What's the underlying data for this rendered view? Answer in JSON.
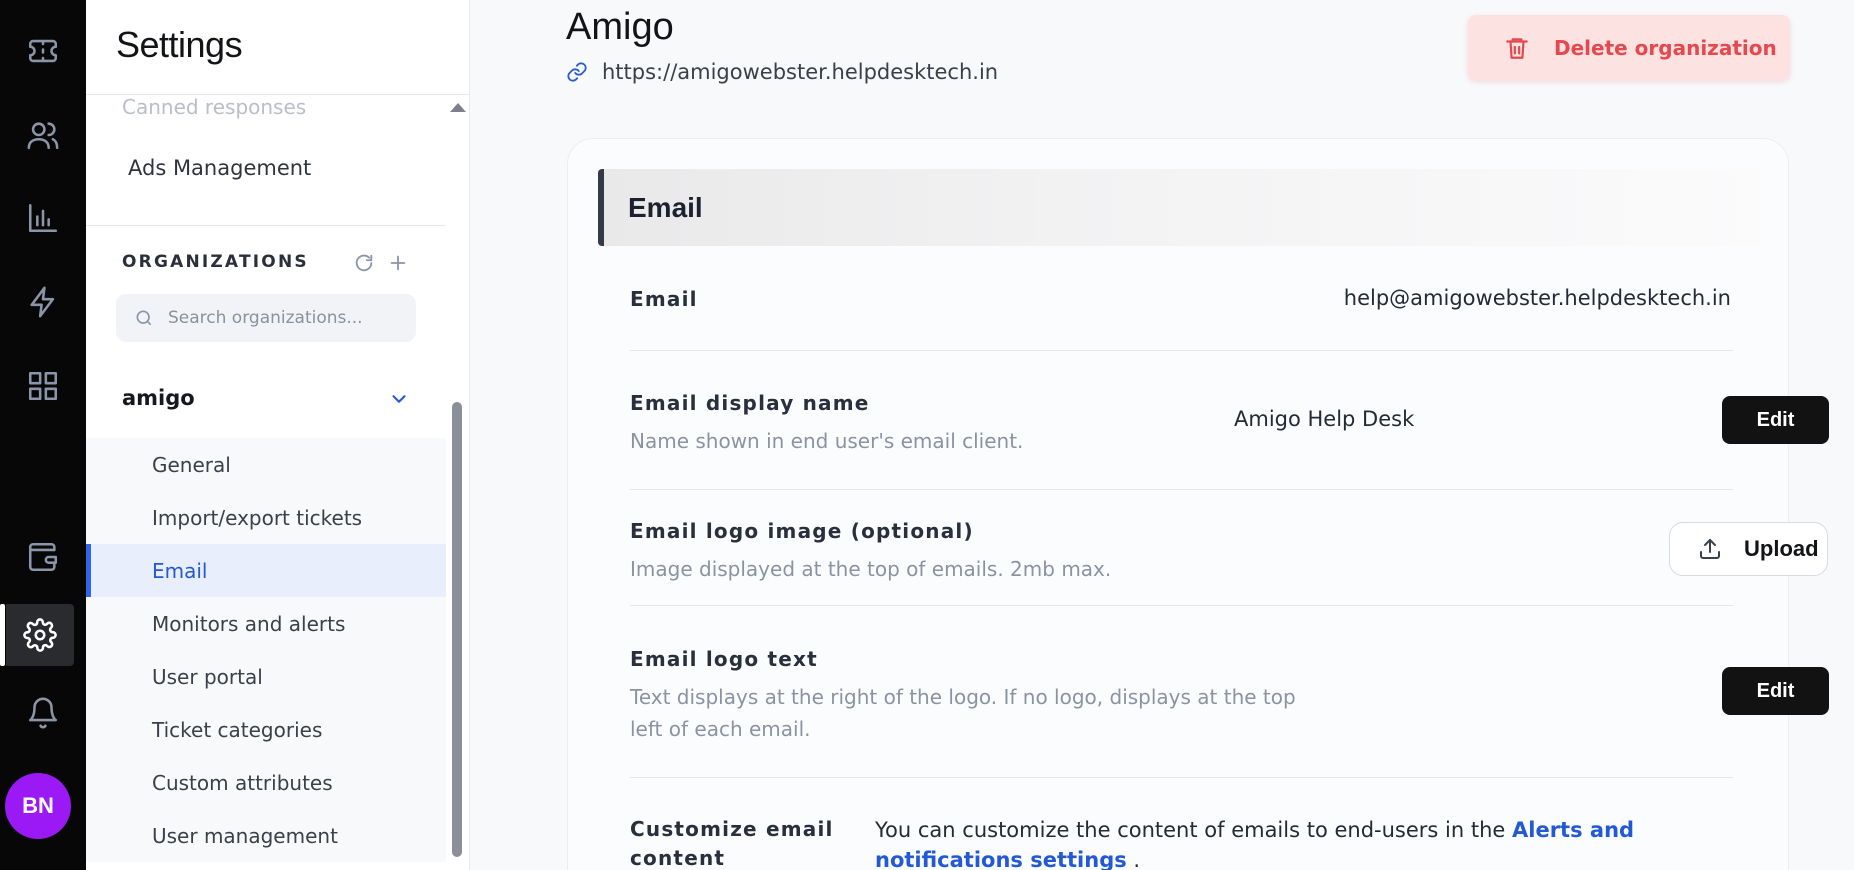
{
  "rail": {
    "items": [
      {
        "icon": "ticket-icon"
      },
      {
        "icon": "users-icon"
      },
      {
        "icon": "chart-icon"
      },
      {
        "icon": "lightning-icon"
      },
      {
        "icon": "apps-grid-icon"
      },
      {
        "icon": "wallet-icon"
      },
      {
        "icon": "gear-icon",
        "active": true
      },
      {
        "icon": "bell-icon"
      }
    ],
    "avatar_initials": "BN",
    "avatar_color": "#9b19f5"
  },
  "sidebar": {
    "title": "Settings",
    "items_above": [
      "Canned responses",
      "Ads Management"
    ],
    "organizations_heading": "ORGANIZATIONS",
    "search_placeholder": "Search organizations...",
    "org_name": "amigo",
    "org_items": [
      "General",
      "Import/export tickets",
      "Email",
      "Monitors and alerts",
      "User portal",
      "Ticket categories",
      "Custom attributes",
      "User management"
    ],
    "active_item": "Email"
  },
  "main": {
    "org_title": "Amigo",
    "org_url": "https://amigowebster.helpdesktech.in",
    "delete_label": "Delete organization",
    "section_title": "Email",
    "rows": {
      "email": {
        "label": "Email",
        "value": "help@amigowebster.helpdesktech.in"
      },
      "display_name": {
        "label": "Email display name",
        "desc": "Name shown in end user's email client.",
        "value": "Amigo Help Desk",
        "button": "Edit"
      },
      "logo_image": {
        "label": "Email logo image (optional)",
        "desc": "Image displayed at the top of emails. 2mb max.",
        "button": "Upload"
      },
      "logo_text": {
        "label": "Email logo text",
        "desc": "Text displays at the right of the logo. If no logo, displays at the top left of each email.",
        "button": "Edit"
      },
      "customize": {
        "label": "Customize email content",
        "text": "You can customize the content of emails to end-users in the ",
        "link": "Alerts and notifications settings",
        "suffix": " ."
      }
    }
  },
  "colors": {
    "accent": "#2459d6",
    "danger": "#e5484d",
    "danger_bg": "#fde2e2",
    "rail_bg": "#070707"
  }
}
